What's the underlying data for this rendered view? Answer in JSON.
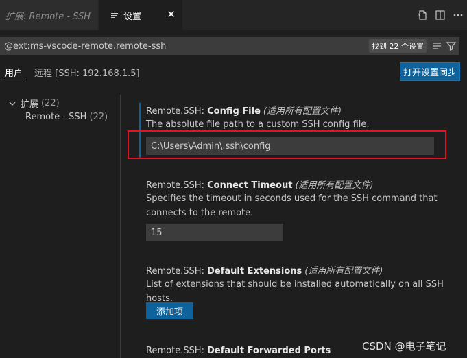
{
  "tabs": [
    {
      "label": "扩展: Remote - SSH",
      "active": false
    },
    {
      "label": "设置",
      "active": true
    }
  ],
  "search": {
    "value": "@ext:ms-vscode-remote.remote-ssh",
    "result_count": "找到 22 个设置"
  },
  "scope_tabs": {
    "user": "用户",
    "remote": "远程 [SSH: 192.168.1.5]"
  },
  "sync_button": "打开设置同步",
  "toc": {
    "group_label": "扩展",
    "group_count": "(22)",
    "item_label": "Remote - SSH",
    "item_count": "(22)"
  },
  "settings": [
    {
      "category": "Remote.SSH: ",
      "key": "Config File",
      "scope": "(适用所有配置文件)",
      "description": "The absolute file path to a custom SSH config file.",
      "value": "C:\\Users\\Admin\\.ssh\\config"
    },
    {
      "category": "Remote.SSH: ",
      "key": "Connect Timeout",
      "scope": "(适用所有配置文件)",
      "description": "Specifies the timeout in seconds used for the SSH command that connects to the remote.",
      "value": "15"
    },
    {
      "category": "Remote.SSH: ",
      "key": "Default Extensions",
      "scope": "(适用所有配置文件)",
      "description": "List of extensions that should be installed automatically on all SSH hosts.",
      "add_button": "添加项"
    },
    {
      "category": "Remote.SSH: ",
      "key": "Default Forwarded Ports"
    }
  ],
  "watermark": "CSDN @电子笔记",
  "colors": {
    "accent": "#0e639c",
    "highlight": "#e81123",
    "background": "#1e1e1e"
  }
}
